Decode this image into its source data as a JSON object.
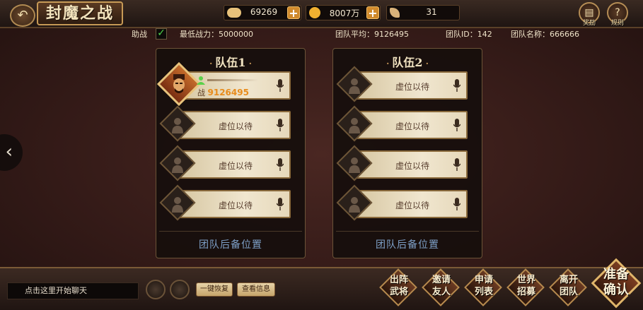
{
  "header": {
    "title": "封魔之战",
    "back_icon": "back-arrow-icon"
  },
  "resources": [
    {
      "name": "ingot",
      "icon": "gold-ingot-icon",
      "value": "69269",
      "color": "#e8c27a",
      "has_plus": true
    },
    {
      "name": "coin",
      "icon": "gold-coin-icon",
      "value": "8007万",
      "color": "#f0b030",
      "has_plus": true
    },
    {
      "name": "feather",
      "icon": "feather-icon",
      "value": "31",
      "color": "#d9b27a",
      "has_plus": false
    }
  ],
  "top_right": {
    "reward_label": "奖励",
    "rules_label": "规则"
  },
  "info": {
    "assist_label": "助战",
    "assist_checked": true,
    "min_power": "最低战力：5000000",
    "team_avg": "团队平均：9126495",
    "team_id": "团队ID：142",
    "team_name": "团队名称：666666"
  },
  "teams": [
    {
      "title": "队伍1",
      "slots": [
        {
          "filled": true,
          "power_label": "战",
          "power": "9126495"
        },
        {
          "filled": false,
          "label": "虚位以待"
        },
        {
          "filled": false,
          "label": "虚位以待"
        },
        {
          "filled": false,
          "label": "虚位以待"
        }
      ],
      "backup": "团队后备位置"
    },
    {
      "title": "队伍2",
      "slots": [
        {
          "filled": false,
          "label": "虚位以待"
        },
        {
          "filled": false,
          "label": "虚位以待"
        },
        {
          "filled": false,
          "label": "虚位以待"
        },
        {
          "filled": false,
          "label": "虚位以待"
        }
      ],
      "backup": "团队后备位置"
    }
  ],
  "bottom": {
    "chat_placeholder": "点击这里开始聊天",
    "btn_recover": "一键恢复",
    "btn_view_info": "查看信息",
    "actions": [
      {
        "label": "出阵武将"
      },
      {
        "label": "邀请友人"
      },
      {
        "label": "申请列表"
      },
      {
        "label": "世界招募"
      },
      {
        "label": "离开团队"
      }
    ],
    "ready": "准备确认"
  },
  "colors": {
    "accent_gold": "#c79a56",
    "panel_bg": "#160e0c",
    "backup_text": "#7ea0c8",
    "check_green": "#4fd34b"
  }
}
